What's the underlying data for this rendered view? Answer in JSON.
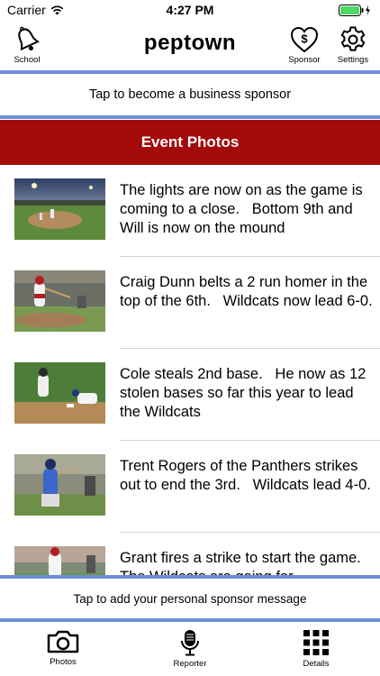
{
  "status": {
    "carrier": "Carrier",
    "time": "4:27 PM",
    "wifi_icon": "wifi-icon",
    "battery_icon": "battery-charging-icon"
  },
  "nav": {
    "brand": "peptown",
    "school_label": "School",
    "sponsor_label": "Sponsor",
    "settings_label": "Settings"
  },
  "sponsor_banner": "Tap to become a business sponsor",
  "section_title": "Event Photos",
  "posts": [
    {
      "text": "The lights are now on as the game is coming to a close.   Bottom 9th and Will is now on the mound"
    },
    {
      "text": "Craig Dunn belts a 2 run homer in the top of the 6th.   Wildcats now lead 6-0."
    },
    {
      "text": "Cole steals 2nd base.   He now as 12 stolen bases so far this year to lead the Wildcats"
    },
    {
      "text": "Trent Rogers of the Panthers strikes out to end the 3rd.   Wildcats lead 4-0."
    },
    {
      "text": "Grant fires a strike to start the game.   The Wildcats are going for"
    }
  ],
  "personal_banner": "Tap to add your personal sponsor message",
  "tabs": {
    "photos": "Photos",
    "reporter": "Reporter",
    "details": "Details"
  },
  "colors": {
    "accent_red": "#a4090b",
    "rule_blue": "#6e8ed8"
  }
}
